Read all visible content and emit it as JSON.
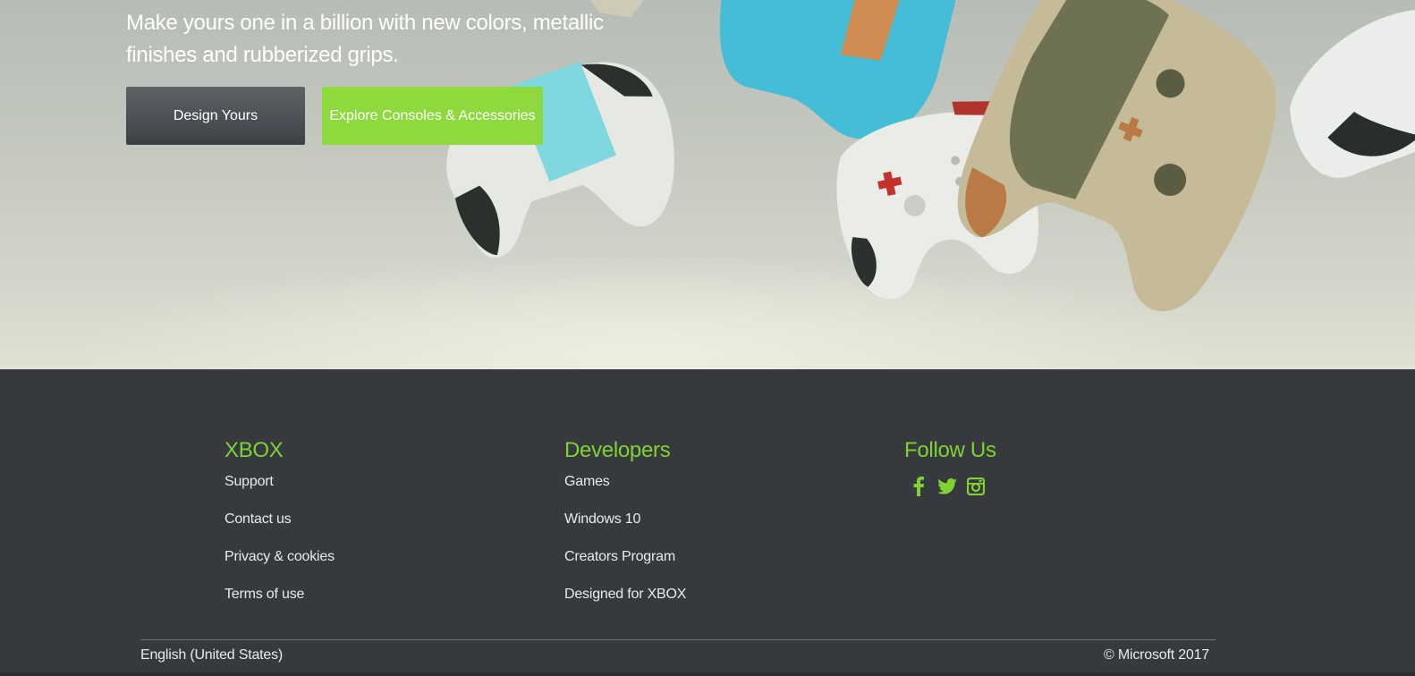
{
  "hero": {
    "tagline": "Make yours one in a billion with new colors, metallic finishes and rubberized grips.",
    "design_button": "Design Yours",
    "explore_button": "Explore Consoles & Accessories"
  },
  "footer": {
    "columns": [
      {
        "heading": "XBOX",
        "links": [
          "Support",
          "Contact us",
          "Privacy & cookies",
          "Terms of use"
        ]
      },
      {
        "heading": "Developers",
        "links": [
          "Games",
          "Windows 10",
          "Creators Program",
          "Designed for XBOX"
        ]
      },
      {
        "heading": "Follow Us",
        "icons": [
          "facebook-icon",
          "twitter-icon",
          "instagram-icon"
        ]
      }
    ],
    "language": "English (United States)",
    "copyright": "© Microsoft 2017"
  },
  "colors": {
    "accent_green": "#7fd330",
    "button_green": "#8ed93d",
    "footer_bg": "#363a3e",
    "button_dark": "#4a4d52"
  }
}
